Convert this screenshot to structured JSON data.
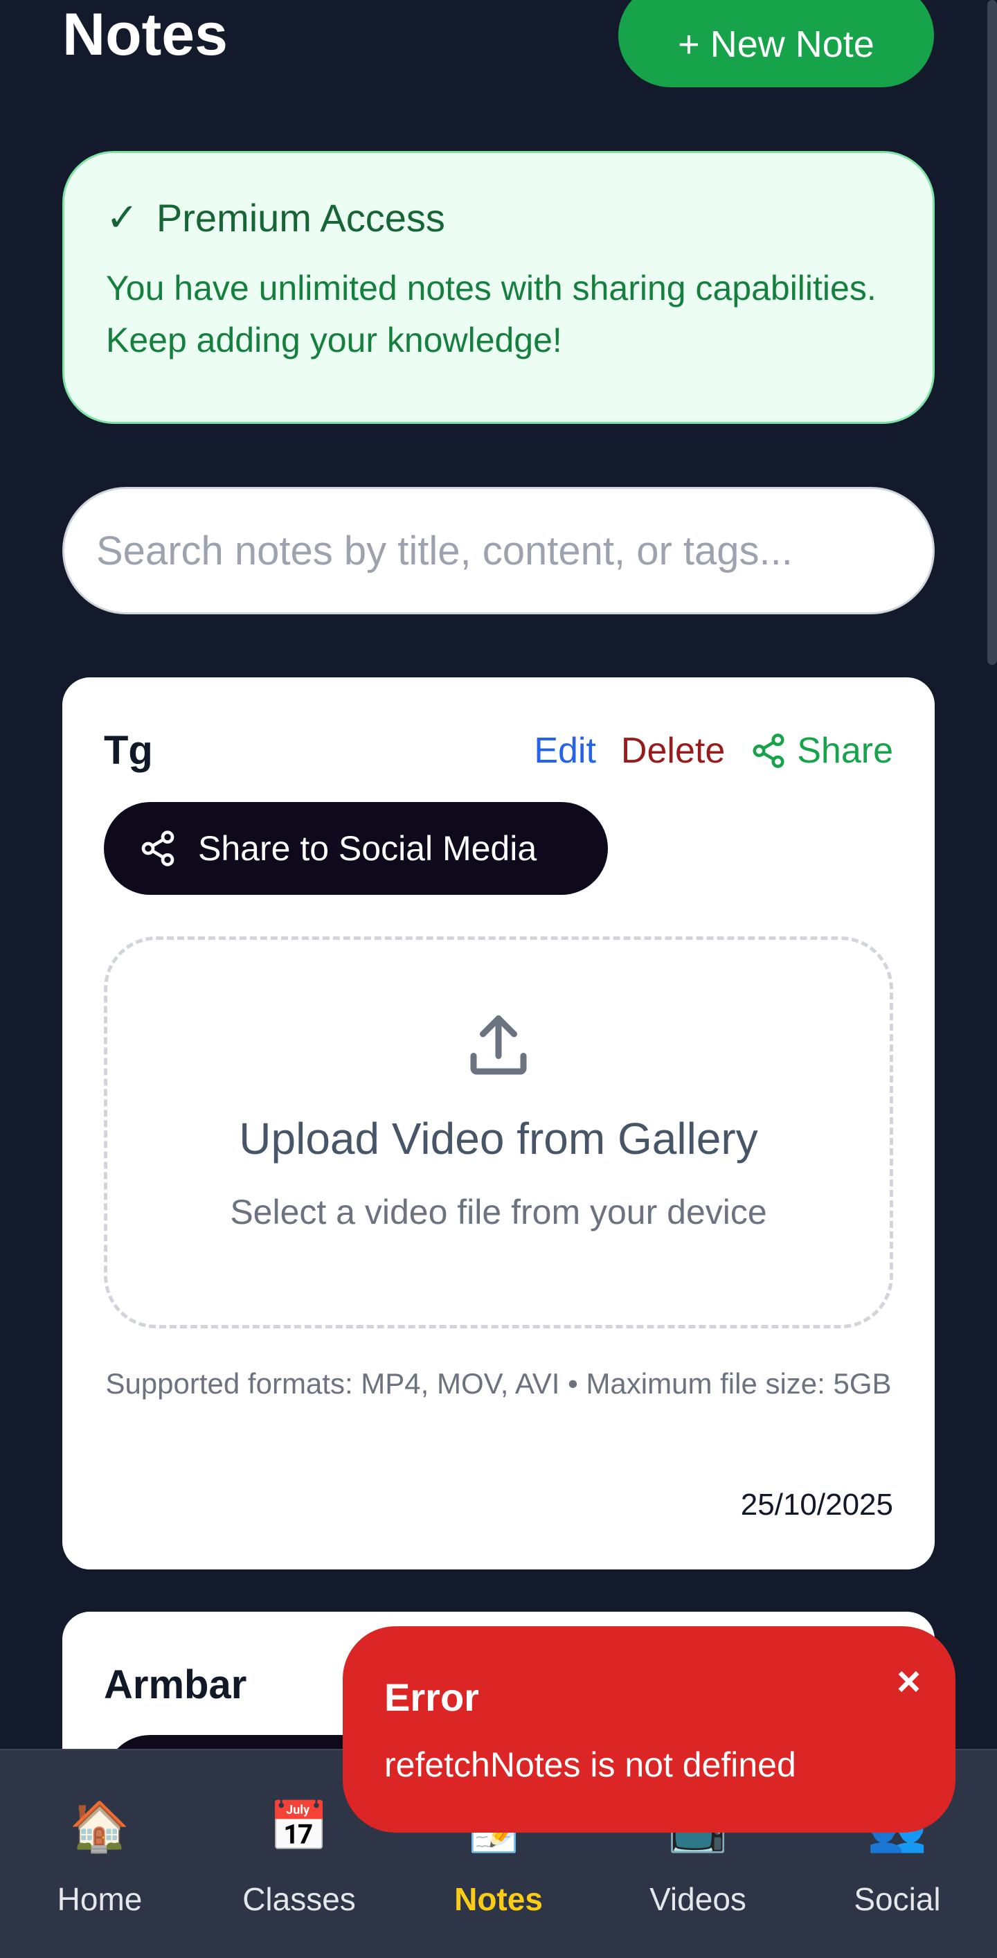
{
  "header": {
    "title": "Notes",
    "new_note_label": "+ New Note"
  },
  "premium": {
    "check": "✓",
    "title": "Premium Access",
    "body": "You have unlimited notes with sharing capabilities. Keep adding your knowledge!"
  },
  "search": {
    "placeholder": "Search notes by title, content, or tags..."
  },
  "notes": [
    {
      "title": "Tg",
      "edit_label": "Edit",
      "delete_label": "Delete",
      "share_label": "Share",
      "social_share_label": "Share to Social Media",
      "upload_title": "Upload Video from Gallery",
      "upload_subtitle": "Select a video file from your device",
      "formats_text": "Supported formats: MP4, MOV, AVI • Maximum file size: 5GB",
      "date": "25/10/2025"
    },
    {
      "title": "Armbar"
    }
  ],
  "toast": {
    "title": "Error",
    "message": "refetchNotes is not defined",
    "close": "×"
  },
  "nav": {
    "items": [
      {
        "label": "Home",
        "icon": "🏠",
        "icon_name": "home-icon"
      },
      {
        "label": "Classes",
        "icon": "📅",
        "icon_name": "calendar-icon"
      },
      {
        "label": "Notes",
        "icon": "📝",
        "icon_name": "notes-icon",
        "active": true
      },
      {
        "label": "Videos",
        "icon": "📺",
        "icon_name": "tv-icon"
      },
      {
        "label": "Social",
        "icon": "👥",
        "icon_name": "people-icon"
      }
    ]
  },
  "colors": {
    "background": "#131a2b",
    "accent_green": "#16a34a",
    "error_red": "#dc2626",
    "active_nav": "#facc15"
  }
}
